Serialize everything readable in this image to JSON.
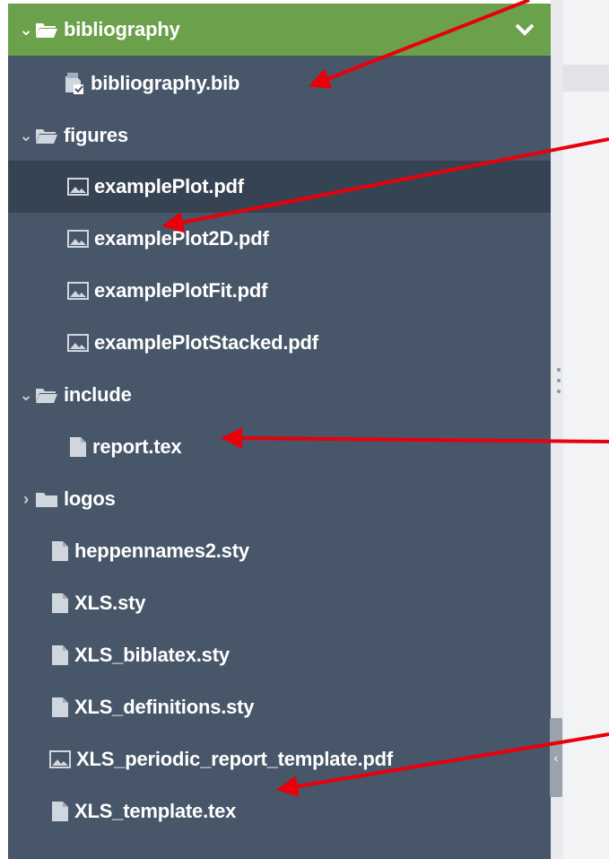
{
  "tree": {
    "rows": [
      {
        "label": "bibliography",
        "kind": "folder-open",
        "expanded": true,
        "state": "active"
      },
      {
        "label": "bibliography.bib",
        "kind": "bib-file"
      },
      {
        "label": "figures",
        "kind": "folder-open",
        "expanded": true
      },
      {
        "label": "examplePlot.pdf",
        "kind": "image-file",
        "state": "selected"
      },
      {
        "label": "examplePlot2D.pdf",
        "kind": "image-file"
      },
      {
        "label": "examplePlotFit.pdf",
        "kind": "image-file"
      },
      {
        "label": "examplePlotStacked.pdf",
        "kind": "image-file"
      },
      {
        "label": "include",
        "kind": "folder-open",
        "expanded": true
      },
      {
        "label": "report.tex",
        "kind": "text-file"
      },
      {
        "label": "logos",
        "kind": "folder-closed",
        "expanded": false
      },
      {
        "label": "heppennames2.sty",
        "kind": "text-file"
      },
      {
        "label": "XLS.sty",
        "kind": "text-file"
      },
      {
        "label": "XLS_biblatex.sty",
        "kind": "text-file"
      },
      {
        "label": "XLS_definitions.sty",
        "kind": "text-file"
      },
      {
        "label": "XLS_periodic_report_template.pdf",
        "kind": "image-file"
      },
      {
        "label": "XLS_template.tex",
        "kind": "text-file"
      }
    ]
  },
  "colors": {
    "panel": "#475668",
    "active_row": "#6ba14a",
    "selected_row": "#364352",
    "annotation_arrow": "#e8000b"
  },
  "icons": {
    "folder_open": "folder-open-icon",
    "folder_closed": "folder-icon",
    "image_file": "image-file-icon",
    "text_file": "file-icon",
    "bib_file": "bib-file-icon",
    "expand": "chevron-down-icon",
    "collapse": "chevron-right-icon",
    "collapse_panel": "chevron-left-icon"
  }
}
